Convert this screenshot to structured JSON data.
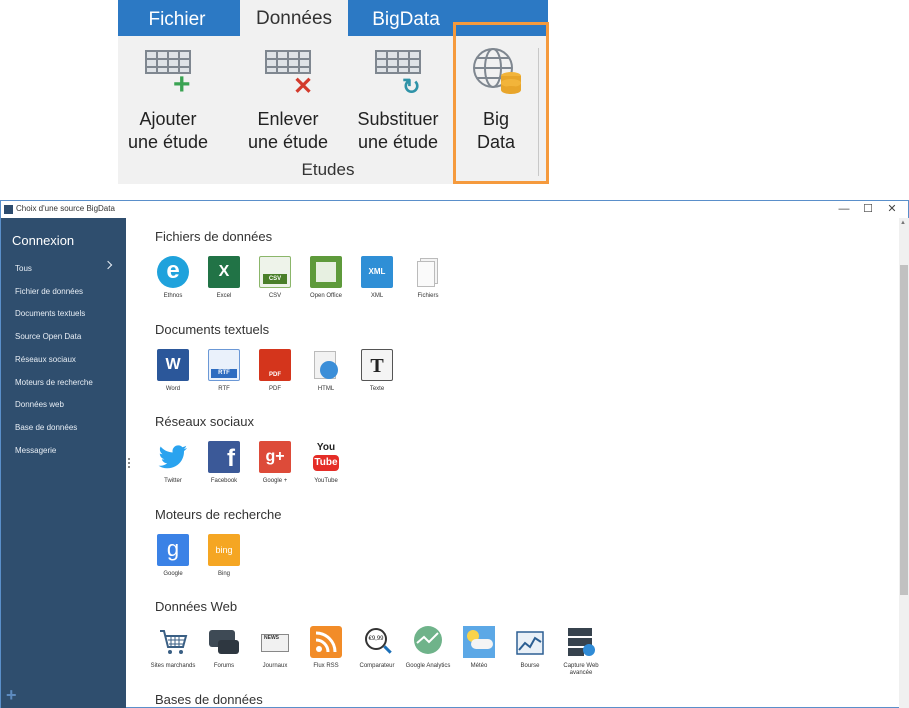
{
  "ribbon": {
    "tabs": [
      {
        "label": "Fichier"
      },
      {
        "label": "Données"
      },
      {
        "label": "BigData"
      }
    ],
    "buttons": [
      {
        "label1": "Ajouter",
        "label2": "une étude"
      },
      {
        "label1": "Enlever",
        "label2": "une étude"
      },
      {
        "label1": "Substituer",
        "label2": "une étude"
      },
      {
        "label1": "Big",
        "label2": "Data"
      }
    ],
    "group_label": "Etudes"
  },
  "dialog": {
    "title": "Choix d'une source BigData",
    "controls": {
      "minimize": "—",
      "maximize": "☐",
      "close": "✕"
    }
  },
  "sidebar": {
    "title": "Connexion",
    "items": [
      {
        "label": "Tous"
      },
      {
        "label": "Fichier de données"
      },
      {
        "label": "Documents textuels"
      },
      {
        "label": "Source Open Data"
      },
      {
        "label": "Réseaux sociaux"
      },
      {
        "label": "Moteurs de recherche"
      },
      {
        "label": "Données web"
      },
      {
        "label": "Base de données"
      },
      {
        "label": "Messagerie"
      }
    ],
    "add": "+"
  },
  "sections": [
    {
      "title": "Fichiers de données",
      "tiles": [
        {
          "label": "Ethnos",
          "glyph": "e"
        },
        {
          "label": "Excel",
          "glyph": "X"
        },
        {
          "label": "CSV",
          "glyph": "CSV"
        },
        {
          "label": "Open Office",
          "glyph": ""
        },
        {
          "label": "XML",
          "glyph": "XML"
        },
        {
          "label": "Fichiers",
          "glyph": ""
        }
      ]
    },
    {
      "title": "Documents textuels",
      "tiles": [
        {
          "label": "Word",
          "glyph": "W"
        },
        {
          "label": "RTF",
          "glyph": "RTF"
        },
        {
          "label": "PDF",
          "glyph": "PDF"
        },
        {
          "label": "HTML",
          "glyph": ""
        },
        {
          "label": "Texte",
          "glyph": "T"
        }
      ]
    },
    {
      "title": "Réseaux sociaux",
      "tiles": [
        {
          "label": "Twitter",
          "glyph": ""
        },
        {
          "label": "Facebook",
          "glyph": "f"
        },
        {
          "label": "Google +",
          "glyph": "g+"
        },
        {
          "label": "YouTube",
          "glyph1": "You",
          "glyph2": "Tube"
        }
      ]
    },
    {
      "title": "Moteurs de recherche",
      "tiles": [
        {
          "label": "Google",
          "glyph": "g"
        },
        {
          "label": "Bing",
          "glyph": "bing"
        }
      ]
    },
    {
      "title": "Données Web",
      "tiles": [
        {
          "label": "Sites marchands"
        },
        {
          "label": "Forums"
        },
        {
          "label": "Journaux",
          "glyph": "NEWS"
        },
        {
          "label": "Flux RSS"
        },
        {
          "label": "Comparateur",
          "glyph": "€9,99"
        },
        {
          "label": "Google Analytics"
        },
        {
          "label": "Météo"
        },
        {
          "label": "Bourse"
        },
        {
          "label": "Capture Web avancée"
        }
      ]
    },
    {
      "title": "Bases de données"
    }
  ],
  "colors": {
    "ribbon_blue": "#2c79c4",
    "sidebar_bg": "#2f4e6e",
    "highlight_orange": "#f59a3d"
  }
}
